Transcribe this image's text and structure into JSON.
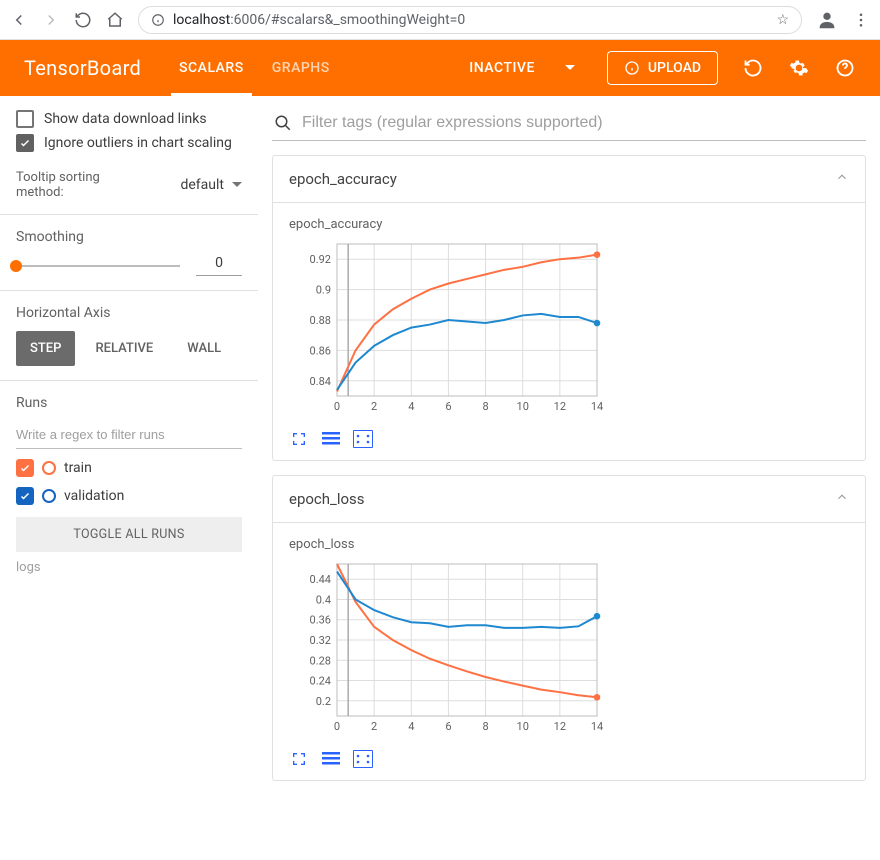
{
  "browser": {
    "url_host": "localhost",
    "url_port_path": ":6006/#scalars&_smoothingWeight=0"
  },
  "header": {
    "logo": "TensorBoard",
    "tabs": {
      "scalars": "SCALARS",
      "graphs": "GRAPHS"
    },
    "inactive": "INACTIVE",
    "upload": "UPLOAD"
  },
  "sidebar": {
    "show_download": "Show data download links",
    "ignore_outliers": "Ignore outliers in chart scaling",
    "tooltip_label": "Tooltip sorting method:",
    "tooltip_value": "default",
    "smoothing_title": "Smoothing",
    "smoothing_value": "0",
    "haxis_title": "Horizontal Axis",
    "haxis": {
      "step": "STEP",
      "relative": "RELATIVE",
      "wall": "WALL"
    },
    "runs_title": "Runs",
    "runs_filter_placeholder": "Write a regex to filter runs",
    "runs": {
      "train": "train",
      "validation": "validation"
    },
    "toggle_all": "TOGGLE ALL RUNS",
    "logs_note": "logs"
  },
  "content": {
    "search_placeholder": "Filter tags (regular expressions supported)",
    "card_acc": {
      "header": "epoch_accuracy",
      "title": "epoch_accuracy"
    },
    "card_loss": {
      "header": "epoch_loss",
      "title": "epoch_loss"
    }
  },
  "chart_data": [
    {
      "type": "line",
      "title": "epoch_accuracy",
      "xlabel": "",
      "ylabel": "",
      "x": [
        0,
        1,
        2,
        3,
        4,
        5,
        6,
        7,
        8,
        9,
        10,
        11,
        12,
        13,
        14
      ],
      "xlim": [
        0,
        14
      ],
      "ylim": [
        0.83,
        0.93
      ],
      "yticks": [
        0.84,
        0.86,
        0.88,
        0.9,
        0.92
      ],
      "xticks": [
        0,
        2,
        4,
        6,
        8,
        10,
        12,
        14
      ],
      "marker_x": 0.6,
      "series": [
        {
          "name": "train",
          "color": "#ff7043",
          "values": [
            0.833,
            0.86,
            0.877,
            0.887,
            0.894,
            0.9,
            0.904,
            0.907,
            0.91,
            0.913,
            0.915,
            0.918,
            0.92,
            0.921,
            0.923
          ]
        },
        {
          "name": "validation",
          "color": "#1e88d0",
          "values": [
            0.834,
            0.852,
            0.863,
            0.87,
            0.875,
            0.877,
            0.88,
            0.879,
            0.878,
            0.88,
            0.883,
            0.884,
            0.882,
            0.882,
            0.878
          ]
        }
      ]
    },
    {
      "type": "line",
      "title": "epoch_loss",
      "xlabel": "",
      "ylabel": "",
      "x": [
        0,
        1,
        2,
        3,
        4,
        5,
        6,
        7,
        8,
        9,
        10,
        11,
        12,
        13,
        14
      ],
      "xlim": [
        0,
        14
      ],
      "ylim": [
        0.17,
        0.47
      ],
      "yticks": [
        0.2,
        0.24,
        0.28,
        0.32,
        0.36,
        0.4,
        0.44
      ],
      "xticks": [
        0,
        2,
        4,
        6,
        8,
        10,
        12,
        14
      ],
      "marker_x": 0.6,
      "series": [
        {
          "name": "train",
          "color": "#ff7043",
          "values": [
            0.5,
            0.395,
            0.346,
            0.32,
            0.3,
            0.283,
            0.27,
            0.258,
            0.247,
            0.238,
            0.23,
            0.222,
            0.217,
            0.211,
            0.207
          ]
        },
        {
          "name": "validation",
          "color": "#1e88d0",
          "values": [
            0.455,
            0.4,
            0.379,
            0.365,
            0.355,
            0.353,
            0.346,
            0.349,
            0.349,
            0.344,
            0.344,
            0.346,
            0.344,
            0.347,
            0.367
          ]
        }
      ]
    }
  ]
}
